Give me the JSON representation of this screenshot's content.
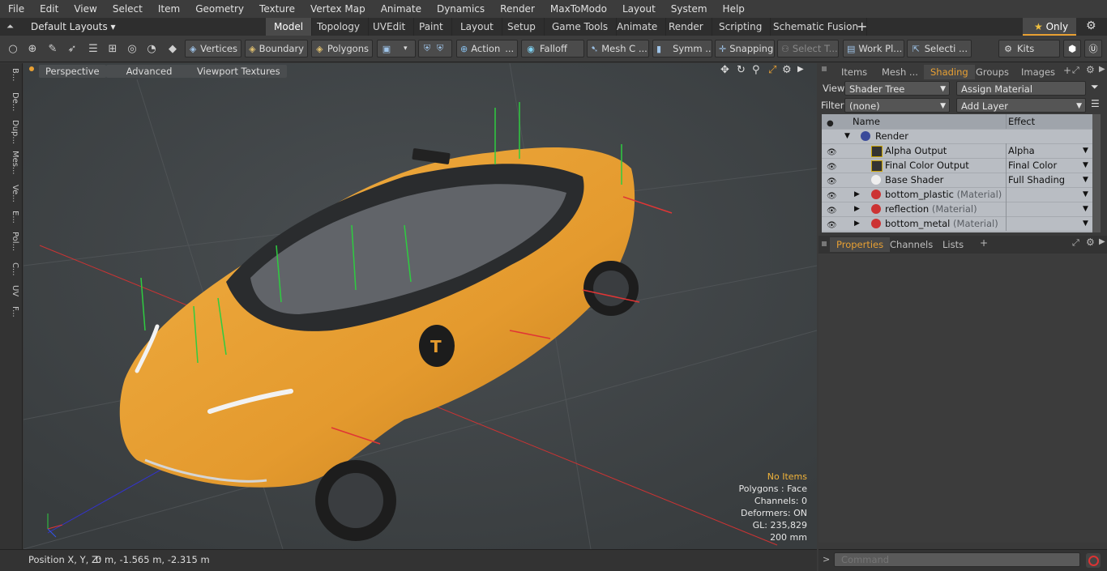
{
  "menu": [
    "File",
    "Edit",
    "View",
    "Select",
    "Item",
    "Geometry",
    "Texture",
    "Vertex Map",
    "Animate",
    "Dynamics",
    "Render",
    "MaxToModo",
    "Layout",
    "System",
    "Help"
  ],
  "layout": {
    "default_layouts": "Default Layouts",
    "tabs": [
      "Model",
      "Topology",
      "UVEdit",
      "Paint",
      "Layout",
      "Setup",
      "Game Tools",
      "Animate",
      "Render",
      "Scripting",
      "Schematic Fusion"
    ],
    "active_tab": "Model",
    "only_label": "Only"
  },
  "toolbar": {
    "vertices": "Vertices",
    "boundary": "Boundary",
    "polygons": "Polygons",
    "action": "Action",
    "falloff": "Falloff",
    "mesh": "Mesh C ...",
    "symm": "Symm ...",
    "snapping": "Snapping",
    "select_t": "Select T...",
    "work_pl": "Work Pl...",
    "selecti": "Selecti ...",
    "kits": "Kits"
  },
  "left_tabs": [
    "B...",
    "De...",
    "Dup...",
    "Mes...",
    "Ve...",
    "E...",
    "Pol...",
    "C...",
    "UV",
    "F..."
  ],
  "viewport": {
    "perspective": "Perspective",
    "advanced": "Advanced",
    "textures": "Viewport Textures",
    "stats": {
      "no_items": "No Items",
      "polygons": "Polygons : Face",
      "channels": "Channels: 0",
      "deformers": "Deformers: ON",
      "gl": "GL: 235,829",
      "scale": "200 mm"
    }
  },
  "right_tabs": [
    "Items",
    "Mesh ...",
    "Shading",
    "Groups",
    "Images"
  ],
  "right_active": "Shading",
  "shading": {
    "view_label": "View",
    "view_value": "Shader Tree",
    "assign_material": "Assign Material",
    "filter_label": "Filter",
    "filter_value": "(none)",
    "add_layer": "Add Layer",
    "col_name": "Name",
    "col_effect": "Effect",
    "rows": [
      {
        "name": "Render",
        "effect": "",
        "kind": "render"
      },
      {
        "name": "Alpha Output",
        "effect": "Alpha",
        "kind": "output"
      },
      {
        "name": "Final Color Output",
        "effect": "Final Color",
        "kind": "output"
      },
      {
        "name": "Base Shader",
        "effect": "Full Shading",
        "kind": "shader"
      },
      {
        "name": "bottom_plastic",
        "tag": "(Material)",
        "effect": "",
        "kind": "material"
      },
      {
        "name": "reflection",
        "tag": "(Material)",
        "effect": "",
        "kind": "material"
      },
      {
        "name": "bottom_metal",
        "tag": "(Material)",
        "effect": "",
        "kind": "material"
      }
    ]
  },
  "props_tabs": [
    "Properties",
    "Channels",
    "Lists"
  ],
  "status": {
    "position_label": "Position X, Y, Z:",
    "position_value": "0 m, -1.565 m, -2.315 m"
  },
  "command_placeholder": "Command",
  "colors": {
    "accent": "#e8a033",
    "taxi": "#e9a236"
  }
}
